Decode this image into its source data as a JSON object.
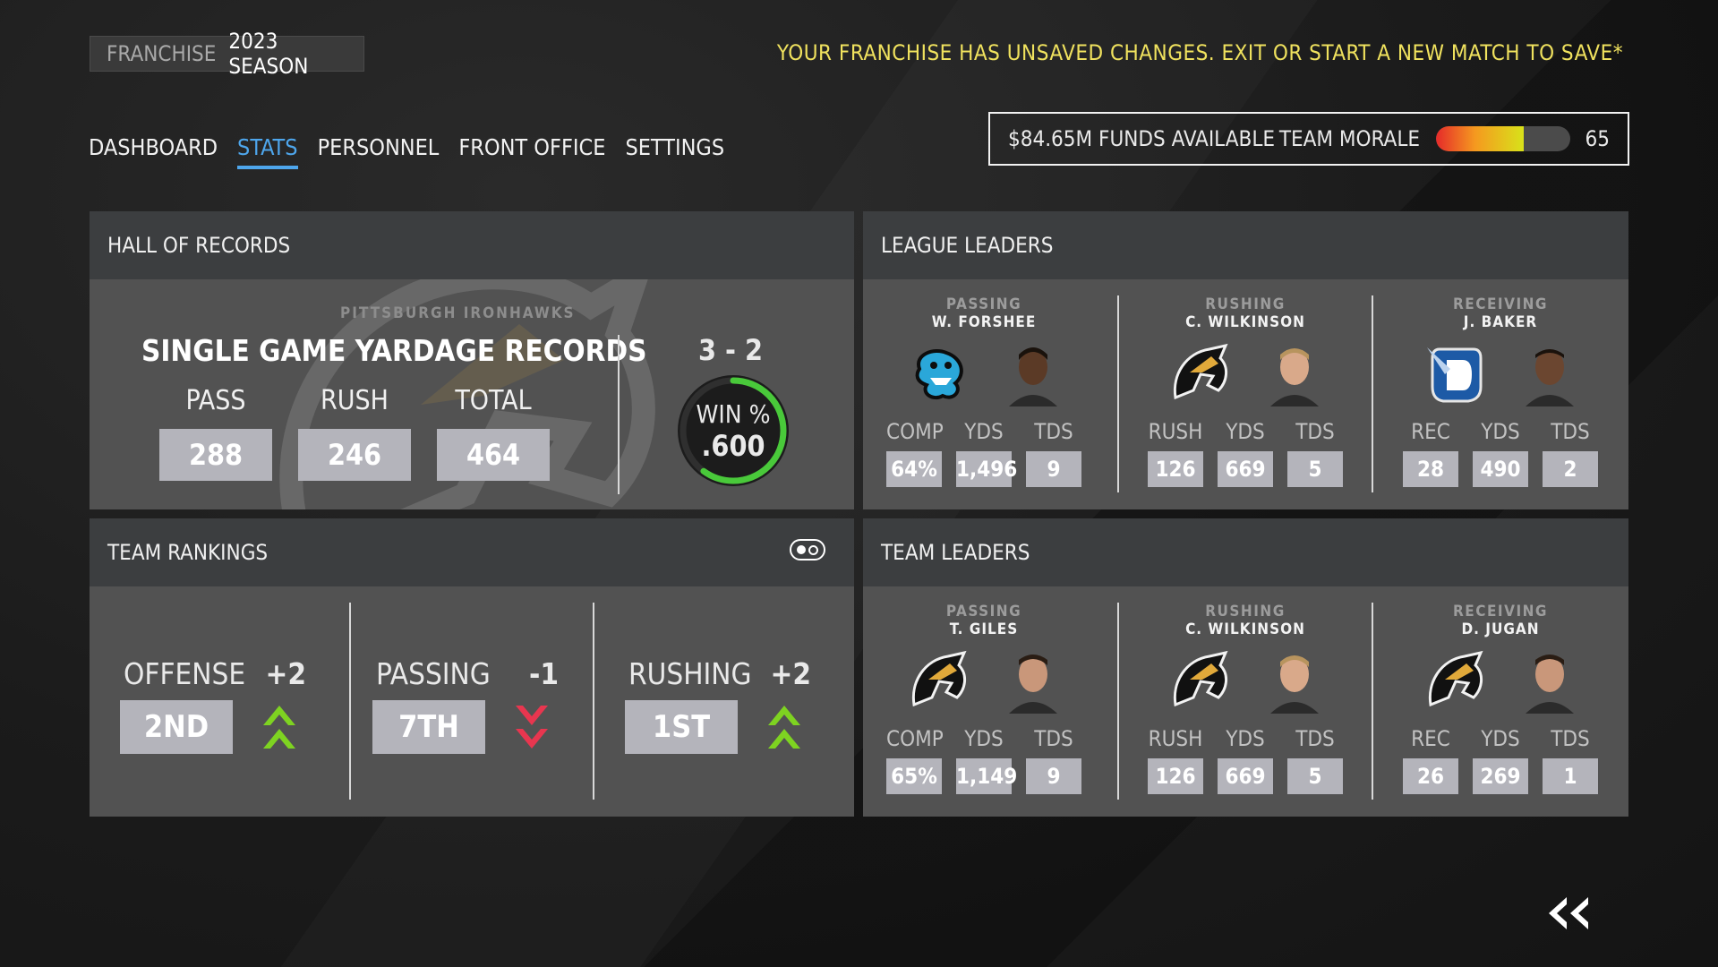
{
  "header": {
    "franchise_label": "FRANCHISE",
    "season_label": "2023 SEASON",
    "unsaved_notice": "YOUR FRANCHISE HAS UNSAVED CHANGES. EXIT OR START A NEW MATCH TO SAVE*"
  },
  "nav": {
    "items": [
      {
        "label": "DASHBOARD"
      },
      {
        "label": "STATS",
        "active": true
      },
      {
        "label": "PERSONNEL"
      },
      {
        "label": "FRONT OFFICE"
      },
      {
        "label": "SETTINGS"
      }
    ]
  },
  "status": {
    "funds": "$84.65M FUNDS AVAILABLE",
    "morale_label": "TEAM MORALE",
    "morale_value": "65",
    "morale_fraction": 0.65
  },
  "hall": {
    "title": "HALL OF RECORDS",
    "team_name": "PITTSBURGH IRONHAWKS",
    "records_title": "SINGLE GAME YARDAGE RECORDS",
    "records": [
      {
        "label": "PASS",
        "value": "288"
      },
      {
        "label": "RUSH",
        "value": "246"
      },
      {
        "label": "TOTAL",
        "value": "464"
      }
    ],
    "record": "3 - 2",
    "win_label": "WIN %",
    "win_pct": ".600",
    "win_fraction": 0.6
  },
  "league_leaders": {
    "title": "LEAGUE LEADERS",
    "leaders": [
      {
        "category": "PASSING",
        "player": "W. FORSHEE",
        "logo": "serpent-logo-icon",
        "labels": [
          "COMP",
          "YDS",
          "TDS"
        ],
        "values": [
          "64%",
          "1,496",
          "9"
        ]
      },
      {
        "category": "RUSHING",
        "player": "C. WILKINSON",
        "logo": "ironhawks-logo-icon",
        "labels": [
          "RUSH",
          "YDS",
          "TDS"
        ],
        "values": [
          "126",
          "669",
          "5"
        ]
      },
      {
        "category": "RECEIVING",
        "player": "J. BAKER",
        "logo": "rocket-shield-logo-icon",
        "labels": [
          "REC",
          "YDS",
          "TDS"
        ],
        "values": [
          "28",
          "490",
          "2"
        ]
      }
    ]
  },
  "team_rankings": {
    "title": "TEAM RANKINGS",
    "toggle_icon": "toggle-icon",
    "ranks": [
      {
        "label": "OFFENSE",
        "change": "+2",
        "rank": "2ND",
        "direction": "up"
      },
      {
        "label": "PASSING",
        "change": "-1",
        "rank": "7TH",
        "direction": "down"
      },
      {
        "label": "RUSHING",
        "change": "+2",
        "rank": "1ST",
        "direction": "up"
      }
    ]
  },
  "team_leaders": {
    "title": "TEAM LEADERS",
    "leaders": [
      {
        "category": "PASSING",
        "player": "T. GILES",
        "logo": "ironhawks-logo-icon",
        "labels": [
          "COMP",
          "YDS",
          "TDS"
        ],
        "values": [
          "65%",
          "1,149",
          "9"
        ]
      },
      {
        "category": "RUSHING",
        "player": "C. WILKINSON",
        "logo": "ironhawks-logo-icon",
        "labels": [
          "RUSH",
          "YDS",
          "TDS"
        ],
        "values": [
          "126",
          "669",
          "5"
        ]
      },
      {
        "category": "RECEIVING",
        "player": "D. JUGAN",
        "logo": "ironhawks-logo-icon",
        "labels": [
          "REC",
          "YDS",
          "TDS"
        ],
        "values": [
          "26",
          "269",
          "1"
        ]
      }
    ]
  },
  "colors": {
    "accent_blue": "#4ea6ec",
    "notice_yellow": "#f0e25e",
    "up_green": "#7ed321",
    "down_red": "#e8364f",
    "win_ring_green": "#49c93a"
  },
  "icons": {
    "back": "double-chevron-left-icon"
  }
}
